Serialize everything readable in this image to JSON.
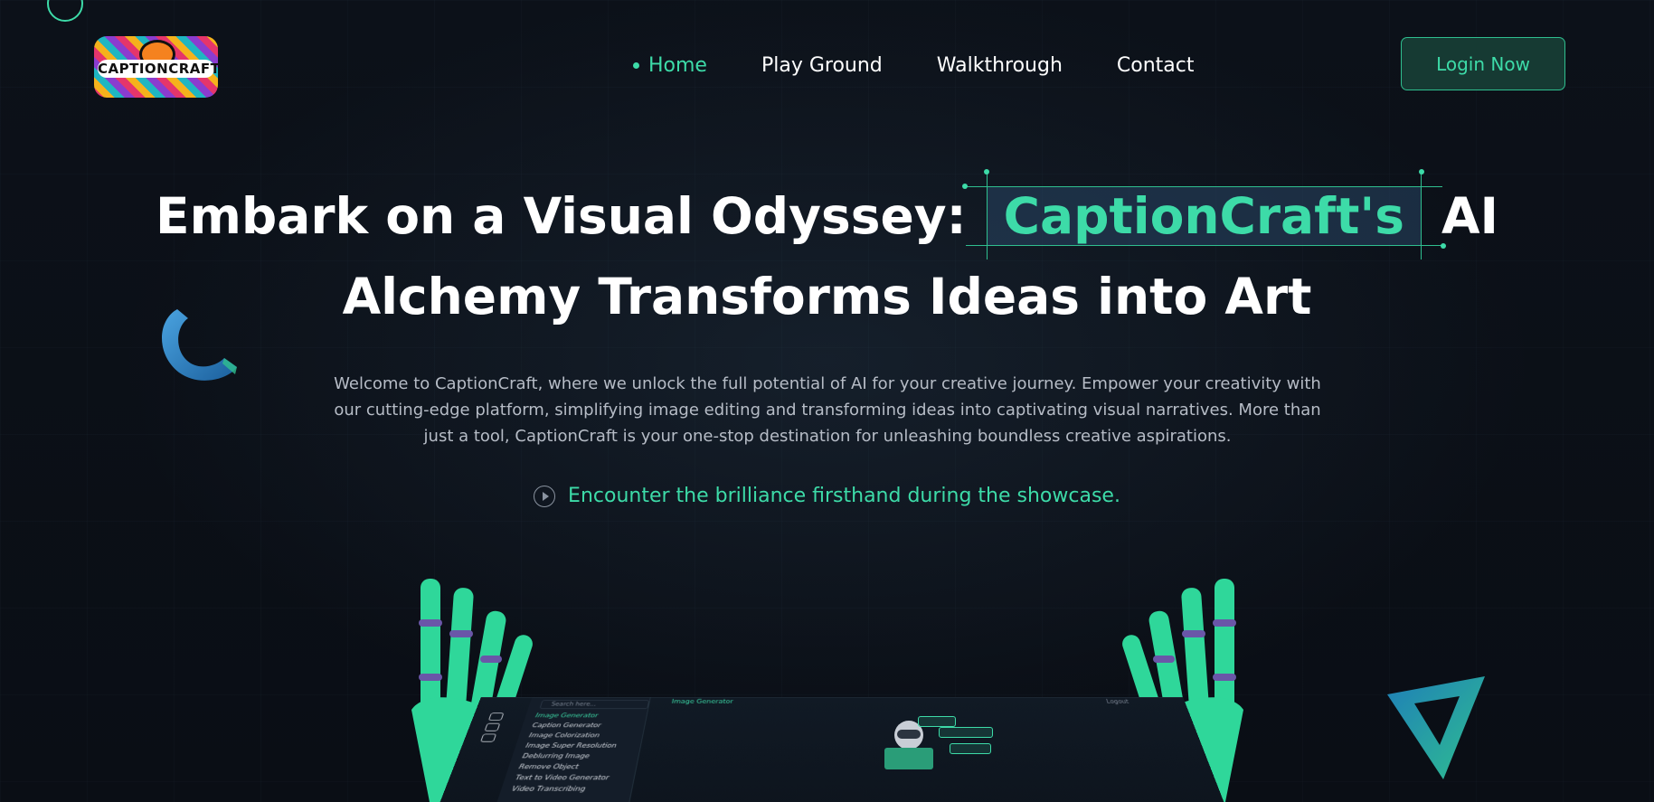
{
  "brand": {
    "logo_text": "CAPTIONCRAFT",
    "accent": "#3ddba8",
    "background": "#0b0f17"
  },
  "nav": {
    "items": [
      {
        "label": "Home",
        "active": true
      },
      {
        "label": "Play Ground",
        "active": false
      },
      {
        "label": "Walkthrough",
        "active": false
      },
      {
        "label": "Contact",
        "active": false
      }
    ],
    "login_label": "Login Now"
  },
  "hero": {
    "title_part1": "Embark on a Visual Odyssey:",
    "title_highlight": "CaptionCraft's",
    "title_part2": "AI",
    "title_line2": "Alchemy Transforms Ideas into Art",
    "lede": "Welcome to CaptionCraft, where we unlock the full potential of AI for your creative journey. Empower your creativity with our cutting-edge platform, simplifying image editing and transforming ideas into captivating visual narratives. More than just a tool, CaptionCraft is your one-stop destination for unleashing boundless creative aspirations.",
    "showcase_text": "Encounter the brilliance firsthand during the showcase.",
    "showcase_icon": "play-circle-icon"
  },
  "illustration": {
    "search_placeholder": "Search here...",
    "title": "Image Generator",
    "right_label": "Logout",
    "menu": [
      {
        "label": "Image Generator",
        "active": true
      },
      {
        "label": "Caption Generator",
        "active": false
      },
      {
        "label": "Image Colorization",
        "active": false
      },
      {
        "label": "Image Super Resolution",
        "active": false
      },
      {
        "label": "Deblurring Image",
        "active": false
      },
      {
        "label": "Remove Object",
        "active": false
      },
      {
        "label": "Text to Video Generator",
        "active": false
      },
      {
        "label": "Video Transcribing",
        "active": false
      }
    ]
  }
}
